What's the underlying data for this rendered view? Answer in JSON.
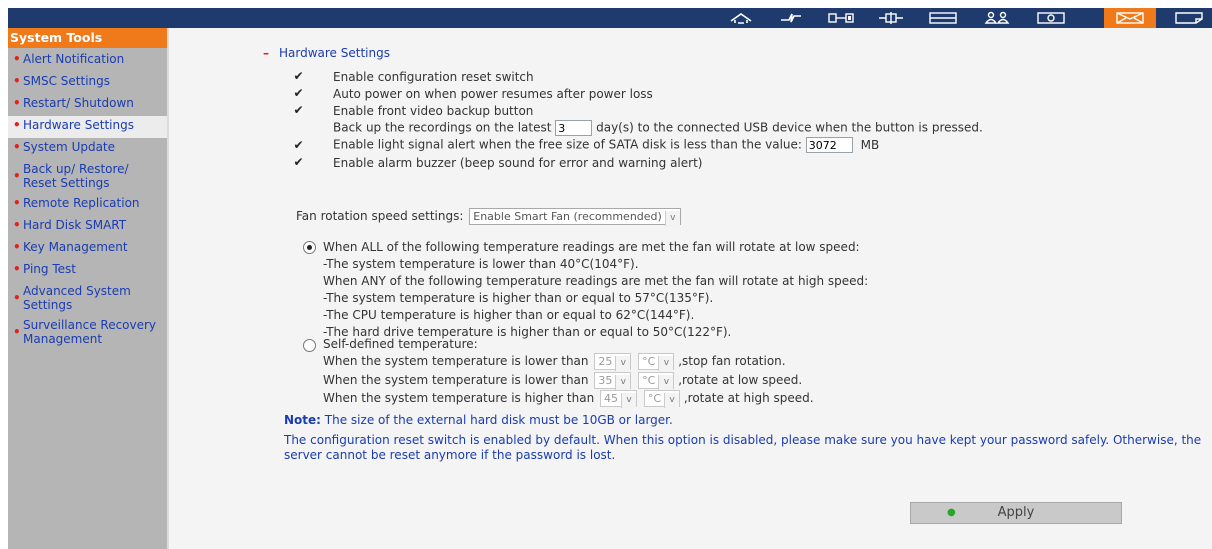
{
  "toolbar": {
    "icons": [
      "home-icon",
      "network-icon",
      "device-icon",
      "connection-icon",
      "storage-icon",
      "users-icon",
      "monitor-icon",
      "mail-icon",
      "log-icon"
    ]
  },
  "sidebar": {
    "title": "System Tools",
    "items": [
      {
        "label": "Alert Notification"
      },
      {
        "label": "SMSC Settings"
      },
      {
        "label": "Restart/ Shutdown"
      },
      {
        "label": "Hardware Settings"
      },
      {
        "label": "System Update"
      },
      {
        "label": "Back up/ Restore/ Reset Settings"
      },
      {
        "label": "Remote Replication"
      },
      {
        "label": "Hard Disk SMART"
      },
      {
        "label": "Key Management"
      },
      {
        "label": "Ping Test"
      },
      {
        "label": "Advanced System Settings"
      },
      {
        "label": "Surveillance Recovery Management"
      }
    ]
  },
  "section": {
    "minus": "–",
    "title": "Hardware Settings"
  },
  "options": {
    "reset_switch": "Enable configuration reset switch",
    "auto_power": "Auto power on when power resumes after power loss",
    "front_backup": "Enable front video backup button",
    "backup_prefix": "Back up the recordings on the latest",
    "backup_days": "3",
    "backup_suffix": "day(s) to the connected USB device when the button is pressed.",
    "light_alert_prefix": "Enable light signal alert when the free size of SATA disk is less than the value:",
    "light_alert_value": "3072",
    "light_alert_unit": "MB",
    "alarm_buzzer": "Enable alarm buzzer (beep sound for error and warning alert)",
    "checkmark": "✔"
  },
  "fan": {
    "label": "Fan rotation speed settings:",
    "mode": "Enable Smart Fan (recommended)",
    "caret": "v",
    "smart_lines": [
      "When ALL of the following temperature readings are met the fan will rotate at low speed:",
      "-The system temperature is lower than 40°C(104°F).",
      "When ANY of the following temperature readings are met the fan will rotate at high speed:",
      "-The system temperature is higher than or equal to 57°C(135°F).",
      "-The CPU temperature is higher than or equal to 62°C(144°F).",
      "-The hard drive temperature is higher than or equal to 50°C(122°F)."
    ],
    "custom_label": "Self-defined temperature:",
    "custom_rows": [
      {
        "prefix": "When the system temperature is lower than",
        "value": "25",
        "unit": "°C",
        "suffix": ",stop fan rotation."
      },
      {
        "prefix": "When the system temperature is lower than",
        "value": "35",
        "unit": "°C",
        "suffix": ",rotate at low speed."
      },
      {
        "prefix": "When the system temperature is higher than",
        "value": "45",
        "unit": "°C",
        "suffix": ",rotate at high speed."
      }
    ]
  },
  "notes": {
    "note_label": "Note:",
    "note_text": "The size of the external hard disk must be 10GB or larger.",
    "reset_line1": "The configuration reset switch is enabled by default. When this option is disabled, please make sure you have kept your password safely. Otherwise, the",
    "reset_line2": "server cannot be reset anymore if the password is lost."
  },
  "apply": {
    "label": "Apply",
    "dot": "●"
  },
  "colors": {
    "topbar": "#1f3b6e",
    "accent": "#f07a1a",
    "link": "#1a3cb0",
    "bullet": "#e0241b"
  }
}
